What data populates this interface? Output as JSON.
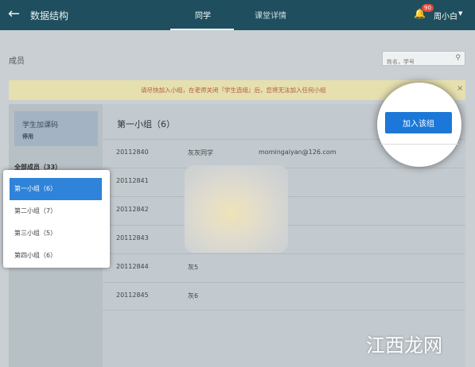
{
  "app": {
    "title": "数据结构",
    "back_icon": "arrow-left-icon"
  },
  "tabs": [
    {
      "label": "同学",
      "active": true
    },
    {
      "label": "课堂详情",
      "active": false
    }
  ],
  "user": {
    "badge_count": "90",
    "name": "周小白",
    "bell_icon": "bell-icon"
  },
  "members": {
    "label": "成员",
    "search_placeholder": "姓名，学号"
  },
  "notice": {
    "text": "请尽快加入小组，在老师关闭『学生选组』后，您将无法加入任何小组",
    "close": "×"
  },
  "left": {
    "code_label": "学生加课码",
    "code_state": "停用",
    "all_members": "全部成员（33）",
    "groups": [
      {
        "label": "第一小组（6）",
        "active": true
      },
      {
        "label": "第二小组（7）",
        "active": false
      },
      {
        "label": "第三小组（5）",
        "active": false
      },
      {
        "label": "第四小组（6）",
        "active": false
      }
    ]
  },
  "group": {
    "title": "第一小组（6）",
    "join_label": "加入该组"
  },
  "students": [
    {
      "id": "20112840",
      "name": "灰灰同学",
      "email": "momingaiyan@126.com"
    },
    {
      "id": "20112841",
      "name": "",
      "email": ""
    },
    {
      "id": "20112842",
      "name": "",
      "email": ""
    },
    {
      "id": "20112843",
      "name": "",
      "email": ""
    },
    {
      "id": "20112844",
      "name": "灰5",
      "email": ""
    },
    {
      "id": "20112845",
      "name": "灰6",
      "email": ""
    }
  ],
  "watermark": "江西龙网",
  "colors": {
    "topbar": "#1f4f5e",
    "accent": "#2f83d8",
    "button": "#1c78d8",
    "notice_bg": "#e6dfae"
  }
}
